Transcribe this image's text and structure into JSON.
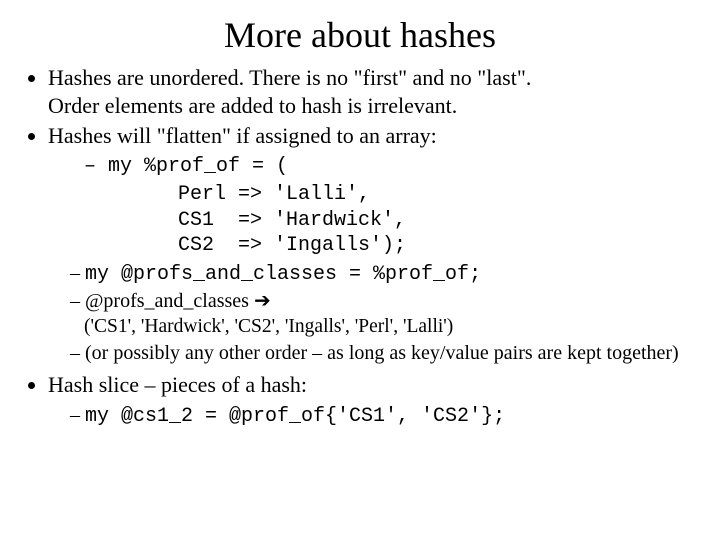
{
  "title": "More about hashes",
  "b1a": "Hashes are unordered.  There is no \"first\" and no \"last\".",
  "b1b": "Order elements are added to hash is irrelevant.",
  "b2": "Hashes will \"flatten\" if assigned to an array:",
  "s1_dash": "– ",
  "s1_code": "my %prof_of = (",
  "s1_body": "     Perl => 'Lalli',\n     CS1  => 'Hardwick',\n     CS2  => 'Ingalls');",
  "s2": "my @profs_and_classes = %prof_of;",
  "s3a": "@profs_and_classes ",
  "s3arrow": "➔",
  "s3b": "('CS1', 'Hardwick', 'CS2', 'Ingalls', 'Perl', 'Lalli')",
  "s4": "(or possibly any other order – as long as key/value pairs are kept together)",
  "b3": "Hash slice – pieces of a hash:",
  "s5": "my @cs1_2 = @prof_of{'CS1', 'CS2'};"
}
